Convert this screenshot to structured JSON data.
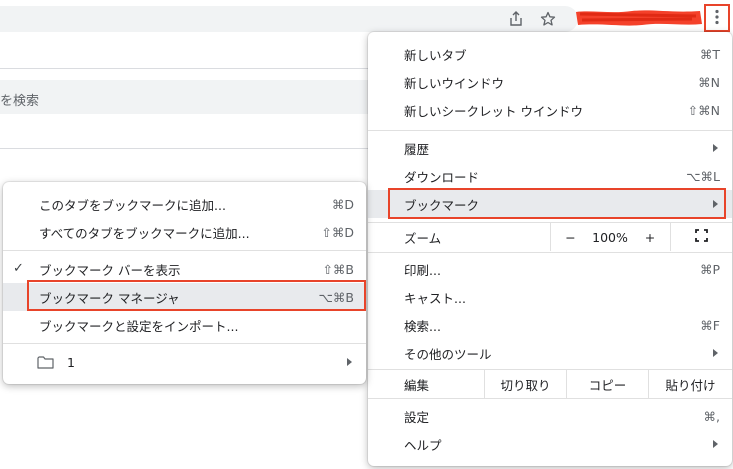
{
  "toolbar": {
    "share_icon": "share-icon",
    "star_icon": "star-icon",
    "menu_icon": "three-dots-vertical-icon",
    "highlight_color": "#e8442a"
  },
  "page": {
    "search_placeholder": "を検索"
  },
  "main_menu": {
    "new_tab": {
      "label": "新しいタブ",
      "shortcut": "⌘T"
    },
    "new_window": {
      "label": "新しいウインドウ",
      "shortcut": "⌘N"
    },
    "incognito": {
      "label": "新しいシークレット ウインドウ",
      "shortcut": "⇧⌘N"
    },
    "history": {
      "label": "履歴"
    },
    "downloads": {
      "label": "ダウンロード",
      "shortcut": "⌥⌘L"
    },
    "bookmarks": {
      "label": "ブックマーク"
    },
    "zoom": {
      "label": "ズーム",
      "minus": "−",
      "level": "100%",
      "plus": "+",
      "fullscreen_icon": "fullscreen-icon"
    },
    "print": {
      "label": "印刷...",
      "shortcut": "⌘P"
    },
    "cast": {
      "label": "キャスト..."
    },
    "find": {
      "label": "検索...",
      "shortcut": "⌘F"
    },
    "more_tools": {
      "label": "その他のツール"
    },
    "edit": {
      "label": "編集",
      "cut": "切り取り",
      "copy": "コピー",
      "paste": "貼り付け"
    },
    "settings": {
      "label": "設定",
      "shortcut": "⌘,"
    },
    "help": {
      "label": "ヘルプ"
    }
  },
  "bookmark_menu": {
    "add_tab": {
      "label": "このタブをブックマークに追加...",
      "shortcut": "⌘D"
    },
    "add_all": {
      "label": "すべてのタブをブックマークに追加...",
      "shortcut": "⇧⌘D"
    },
    "show_bar": {
      "label": "ブックマーク バーを表示",
      "shortcut": "⇧⌘B",
      "checkmark": "✓"
    },
    "manager": {
      "label": "ブックマーク マネージャ",
      "shortcut": "⌥⌘B"
    },
    "import": {
      "label": "ブックマークと設定をインポート..."
    },
    "folder": {
      "label": "1",
      "icon": "folder-icon"
    }
  }
}
